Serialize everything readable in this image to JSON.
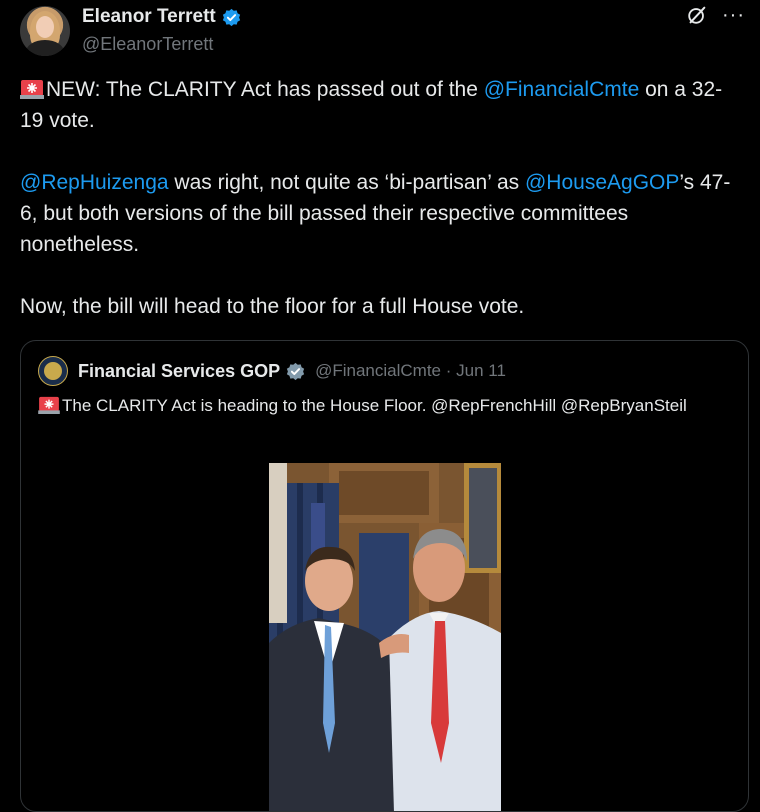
{
  "author": {
    "display_name": "Eleanor Terrett",
    "handle": "@EleanorTerrett",
    "verified_icon": "verified-badge-icon",
    "avatar_icon": "profile-photo"
  },
  "tweet": {
    "p1": {
      "text_a": "NEW: The CLARITY Act has passed out of the ",
      "mention": "@FinancialCmte",
      "text_b": " on a 32-19 vote."
    },
    "p2": {
      "mention_a": "@RepHuizenga",
      "text_a": " was right, not quite as ‘bi-partisan’ as ",
      "mention_b": "@HouseAgGOP",
      "text_b": "’s 47-6, but both versions of the bill passed their respective committees nonetheless."
    },
    "p3": "Now, the bill will head to the floor for a full House vote."
  },
  "quoted": {
    "display_name": "Financial Services GOP",
    "handle_date": "@FinancialCmte · Jun 11",
    "text": "The CLARITY Act is heading to the House Floor. @RepFrenchHill @RepBryanSteil"
  },
  "colors": {
    "background": "#000000",
    "text": "#e7e9ea",
    "secondary": "#71767b",
    "link": "#1d9bf0",
    "verified": "#1d9bf0",
    "border": "#2f3336"
  }
}
